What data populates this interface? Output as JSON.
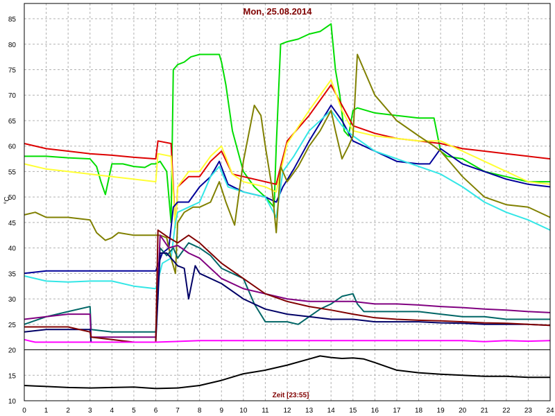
{
  "chart_data": {
    "type": "line",
    "title": "Mon, 25.08.2014",
    "xlabel": "Zeit [23:55]",
    "ylabel": "°C",
    "xlim": [
      0,
      24
    ],
    "ylim": [
      10,
      88
    ],
    "grid": true,
    "x_ticks": [
      0,
      1,
      2,
      3,
      4,
      5,
      6,
      7,
      8,
      9,
      10,
      11,
      12,
      13,
      14,
      15,
      16,
      17,
      18,
      19,
      20,
      21,
      22,
      23,
      24
    ],
    "y_ticks": [
      10,
      15,
      20,
      25,
      30,
      35,
      40,
      45,
      50,
      55,
      60,
      65,
      70,
      75,
      80,
      85
    ],
    "colors": {
      "grid": "#b0b0b0",
      "frame": "#000000",
      "divider": "#000000"
    },
    "series": [
      {
        "color": "#00dd00",
        "x": [
          0,
          1,
          2,
          3,
          3.3,
          3.5,
          3.7,
          4,
          4.5,
          5,
          5.5,
          5.8,
          6.0,
          6.2,
          6.5,
          6.7,
          6.8,
          7,
          7.3,
          7.6,
          8,
          8.5,
          8.9,
          9,
          9.2,
          9.5,
          10,
          10.5,
          11,
          11.3,
          11.4,
          11.5,
          11.7,
          12,
          12.5,
          13,
          13.5,
          14,
          14.2,
          14.4,
          14.6,
          14.8,
          15,
          15.2,
          16,
          17,
          18,
          18.7,
          19,
          19.3,
          20,
          21,
          22,
          23,
          24
        ],
        "y": [
          58,
          58,
          57.7,
          57.5,
          56,
          53,
          50.5,
          56.5,
          56.5,
          56,
          55.8,
          56.5,
          56.5,
          57,
          55,
          45,
          75,
          76,
          76.5,
          77.5,
          78,
          78,
          78,
          76.5,
          72,
          63,
          55,
          52,
          50,
          48.5,
          48,
          60,
          80,
          80.5,
          81,
          82,
          82.5,
          84,
          75,
          70,
          63,
          62,
          67,
          67.5,
          66.5,
          66,
          65.5,
          65.5,
          59,
          58,
          57.5,
          55,
          54,
          53,
          53
        ]
      },
      {
        "color": "#dd0000",
        "x": [
          0,
          1,
          2,
          3,
          4,
          5,
          6,
          6.1,
          6.7,
          6.9,
          7,
          7.5,
          8,
          8.5,
          9,
          9.5,
          10,
          11,
          11.5,
          11.7,
          12,
          13,
          14,
          14.5,
          15,
          16,
          17,
          18,
          19,
          20,
          21,
          22,
          23,
          24
        ],
        "y": [
          60.5,
          59.5,
          59,
          58.5,
          58.2,
          57.8,
          57.5,
          61,
          60.5,
          44,
          52,
          54,
          54,
          57,
          59,
          54.5,
          54,
          53,
          52.5,
          56,
          61,
          66,
          72,
          68,
          64,
          62.5,
          61.5,
          61,
          60.5,
          59.5,
          59,
          58.5,
          58,
          57.5
        ]
      },
      {
        "color": "#ffff33",
        "x": [
          0,
          1,
          2,
          3,
          4,
          5,
          6,
          6.1,
          6.7,
          6.9,
          7,
          7.5,
          8,
          8.5,
          9,
          9.5,
          10,
          11,
          11.5,
          11.7,
          12,
          13,
          14,
          14.5,
          15,
          16,
          17,
          18,
          19,
          20,
          21,
          22,
          23,
          24
        ],
        "y": [
          56.5,
          55.5,
          55,
          54.5,
          54,
          53.5,
          53,
          58.5,
          58,
          44,
          52,
          55,
          55,
          58,
          60,
          54.5,
          53,
          52,
          51,
          55,
          60.5,
          67,
          73,
          67,
          63,
          62,
          61.5,
          61,
          61,
          59,
          57,
          55,
          53,
          52.5
        ]
      },
      {
        "color": "#000099",
        "x": [
          0,
          1,
          2,
          3,
          4,
          5,
          6,
          6.3,
          6.6,
          6.8,
          7,
          7.5,
          8,
          8.5,
          8.9,
          9.3,
          10,
          11,
          11.5,
          11.8,
          12.3,
          13,
          14,
          14.5,
          15,
          16,
          17,
          18,
          18.5,
          19,
          20,
          21,
          22,
          23,
          24
        ],
        "y": [
          35,
          35.5,
          35.5,
          35.5,
          35.5,
          35.5,
          35.5,
          39,
          40,
          48,
          49,
          49,
          52,
          54,
          57,
          52.5,
          51,
          50,
          49,
          52,
          55.5,
          61,
          68,
          65,
          61,
          59,
          57,
          56.5,
          56.5,
          59.5,
          56.5,
          55,
          53.5,
          52.5,
          52
        ]
      },
      {
        "color": "#33e6e6",
        "x": [
          0,
          1,
          2,
          3,
          4,
          5,
          6,
          6.3,
          6.7,
          6.9,
          7,
          7.5,
          8,
          8.5,
          8.9,
          9.3,
          10,
          11,
          11.5,
          11.8,
          12.3,
          13,
          14,
          14.5,
          15,
          16,
          17,
          18,
          19,
          20,
          21,
          22,
          23,
          24
        ],
        "y": [
          34.5,
          33.5,
          33.3,
          33.5,
          33.5,
          32.5,
          32,
          37,
          38,
          45,
          47,
          48,
          49,
          54,
          56,
          52,
          51,
          50,
          46,
          55,
          58,
          63,
          67,
          64,
          62,
          59,
          57.5,
          56,
          54.5,
          52,
          49,
          47,
          45.5,
          43.5
        ]
      },
      {
        "color": "#808000",
        "x": [
          0,
          0.5,
          1,
          2,
          3,
          3.3,
          3.7,
          4,
          4.3,
          5,
          6,
          6.2,
          6.5,
          6.7,
          6.9,
          7,
          7.3,
          7.7,
          8,
          8.5,
          8.9,
          9.2,
          9.6,
          10,
          10.5,
          10.8,
          11,
          11.3,
          11.5,
          11.7,
          12,
          12.5,
          13,
          13.5,
          14,
          14.2,
          14.5,
          14.8,
          15,
          15.2,
          16,
          17,
          18,
          18.7,
          19,
          20,
          21,
          22,
          23,
          24
        ],
        "y": [
          46.5,
          47,
          46,
          46,
          45.5,
          43,
          41.5,
          42,
          43,
          42.5,
          42.5,
          42.5,
          42,
          38,
          35,
          45,
          47,
          48,
          48,
          49,
          53,
          49,
          44.5,
          57,
          68,
          66,
          60,
          52,
          43,
          56,
          53,
          56,
          60,
          63,
          67,
          63,
          57.5,
          60,
          62,
          78,
          70,
          65,
          62,
          60,
          59,
          54,
          50,
          48.5,
          48,
          46
        ]
      },
      {
        "color": "#006666",
        "x": [
          0,
          1,
          2,
          3,
          3.05,
          4,
          5,
          6,
          6.2,
          6.5,
          6.8,
          7,
          7.5,
          8,
          8.5,
          9,
          10,
          10.5,
          11,
          11.5,
          12,
          12.5,
          13,
          13.5,
          14,
          14.5,
          15,
          15.2,
          15.5,
          16,
          17,
          18,
          19,
          20,
          21,
          22,
          23,
          24
        ],
        "y": [
          25,
          26.5,
          27.5,
          28.5,
          24,
          23.5,
          23.5,
          23.5,
          40,
          38.5,
          40,
          38,
          41,
          40,
          38.5,
          36,
          34,
          29,
          25.5,
          25.5,
          25.5,
          25,
          26.5,
          28,
          29,
          30.5,
          31,
          29,
          27.5,
          27.5,
          27.5,
          27.5,
          27,
          26.5,
          26.5,
          26,
          26,
          26
        ]
      },
      {
        "color": "#800080",
        "x": [
          0,
          1,
          2,
          3,
          3.05,
          4,
          5,
          6,
          6.2,
          6.6,
          7,
          7.5,
          8,
          8.5,
          9,
          10,
          11,
          12,
          13,
          14,
          15,
          16,
          17,
          18,
          19,
          20,
          21,
          22,
          23,
          24
        ],
        "y": [
          26,
          26.5,
          27,
          27,
          22.5,
          22.5,
          22.5,
          22.5,
          42.5,
          40,
          40.5,
          39,
          38,
          36,
          34,
          32,
          31,
          30,
          29.5,
          29.5,
          29.5,
          29,
          29,
          28.8,
          28.5,
          28.3,
          28,
          27.8,
          27.5,
          27.3
        ]
      },
      {
        "color": "#000066",
        "x": [
          0,
          1,
          2,
          3,
          3.05,
          4,
          5,
          6,
          6.2,
          6.5,
          7,
          7.3,
          7.5,
          7.8,
          8,
          9,
          10,
          11,
          12,
          13,
          14,
          15,
          16,
          17,
          18,
          19,
          20,
          21,
          22,
          23,
          24
        ],
        "y": [
          23.5,
          24,
          24,
          24,
          21.5,
          21.5,
          21.5,
          21.5,
          39,
          39,
          36.5,
          36,
          30,
          36.5,
          35,
          33,
          30,
          28,
          27,
          26.5,
          26,
          26,
          25.5,
          25.5,
          25.5,
          25.3,
          25.2,
          25,
          25,
          25,
          24.8
        ]
      },
      {
        "color": "#800000",
        "x": [
          0,
          1,
          2,
          3,
          3.05,
          4,
          5,
          6,
          6.1,
          6.6,
          7,
          7.5,
          8,
          8.5,
          9,
          10,
          11,
          12,
          13,
          14,
          15,
          16,
          17,
          18,
          19,
          20,
          21,
          22,
          23,
          24
        ],
        "y": [
          24.5,
          24.5,
          24.5,
          23.5,
          22.5,
          22,
          21.5,
          21.5,
          43.5,
          42,
          41,
          42.5,
          41,
          39,
          37,
          34,
          31,
          29.5,
          28.5,
          27.8,
          27,
          26.3,
          26,
          25.8,
          25.7,
          25.5,
          25.3,
          25.2,
          25,
          24.8
        ]
      },
      {
        "color": "#ff00ff",
        "x": [
          0,
          0.3,
          0.5,
          3,
          6,
          8,
          9,
          10,
          12,
          14,
          16,
          18,
          20,
          21,
          22,
          23,
          24
        ],
        "y": [
          22,
          21.7,
          21.5,
          21.5,
          21.5,
          21.8,
          21.8,
          21.8,
          21.8,
          21.8,
          21.8,
          21.8,
          21.8,
          21.6,
          21.8,
          21.7,
          21.8
        ]
      },
      {
        "color": "#000000",
        "x": [
          0,
          0.5,
          1,
          2,
          3,
          4,
          5,
          6,
          7,
          8,
          9,
          10,
          11,
          12,
          13,
          13.5,
          14,
          14.5,
          15,
          15.5,
          16,
          17,
          18,
          19,
          20,
          21,
          22,
          23,
          24
        ],
        "y": [
          13,
          12.9,
          12.8,
          12.6,
          12.5,
          12.6,
          12.7,
          12.4,
          12.5,
          13,
          14,
          15.3,
          16,
          17,
          18.2,
          18.8,
          18.5,
          18.3,
          18.4,
          18.2,
          17.5,
          16,
          15.5,
          15.2,
          15,
          14.8,
          14.8,
          14.6,
          14.6
        ]
      }
    ]
  }
}
